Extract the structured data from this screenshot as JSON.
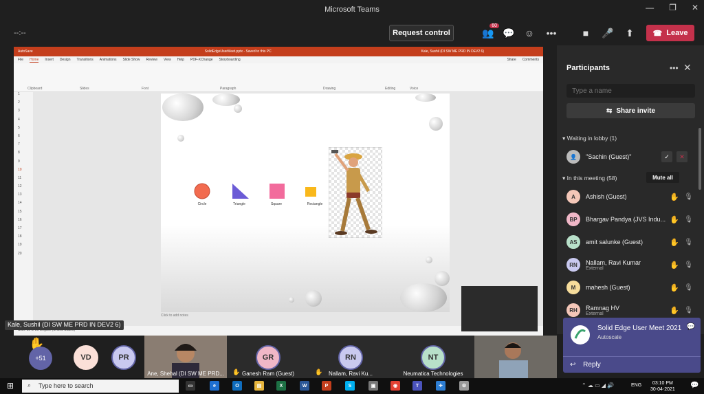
{
  "window": {
    "title": "Microsoft Teams"
  },
  "toolbar": {
    "timer": "--:--",
    "request_control": "Request control",
    "participants_badge": "60",
    "leave_label": "Leave"
  },
  "presentation": {
    "file_title": "SolidEdgeUserMeet.pptx - Saved to this PC",
    "user": "Kale, Sushil (DI SW ME PRD IN DEV2 6)",
    "autosave": "AutoSave",
    "tabs": [
      "File",
      "Home",
      "Insert",
      "Design",
      "Transitions",
      "Animations",
      "Slide Show",
      "Review",
      "View",
      "Help",
      "PDF-XChange",
      "Storyboarding"
    ],
    "share_label": "Share",
    "comments_label": "Comments",
    "ribbon_groups": [
      "Clipboard",
      "Slides",
      "Font",
      "Paragraph",
      "Drawing",
      "Editing",
      "Voice"
    ],
    "slide_numbers": [
      "1",
      "2",
      "3",
      "4",
      "5",
      "6",
      "7",
      "8",
      "9",
      "10",
      "11",
      "12",
      "13",
      "14",
      "15",
      "16",
      "17",
      "18",
      "19",
      "20"
    ],
    "shapes": [
      "Circle",
      "Triangle",
      "Square",
      "Rectangle"
    ],
    "notes_placeholder": "Click to add notes",
    "status": "Slide 10 of 20    English (United States)"
  },
  "presenter_tag": "Kale, Sushil (DI SW ME PRD IN DEV2 6)",
  "participants_panel": {
    "title": "Participants",
    "search_placeholder": "Type a name",
    "share_invite": "Share invite",
    "waiting_header": "Waiting in lobby (1)",
    "lobby": [
      {
        "name": "\"Sachin (Guest)\""
      }
    ],
    "meeting_header": "In this meeting (58)",
    "mute_all": "Mute all",
    "people": [
      {
        "initials": "A",
        "name": "Ashish (Guest)",
        "sub": "",
        "color": "#f4c7b8"
      },
      {
        "initials": "BP",
        "name": "Bhargav Pandya (JVS Indu...",
        "sub": "",
        "color": "#f0b7c7"
      },
      {
        "initials": "AS",
        "name": "amit salunke (Guest)",
        "sub": "",
        "color": "#b8e0c9"
      },
      {
        "initials": "RN",
        "name": "Nallam, Ravi Kumar",
        "sub": "External",
        "color": "#c9c9ef"
      },
      {
        "initials": "M",
        "name": "mahesh (Guest)",
        "sub": "",
        "color": "#f6dc9b"
      },
      {
        "initials": "RH",
        "name": "Ramnag HV",
        "sub": "External",
        "color": "#f4c7b8"
      }
    ]
  },
  "toast": {
    "title": "Solid Edge User Meet 2021",
    "subtitle": "Autoscale",
    "reply": "Reply"
  },
  "video_strip": {
    "raised_hands": "+51",
    "tiles": [
      {
        "initials": "VD",
        "label": ""
      },
      {
        "initials": "PR",
        "label": ""
      },
      {
        "initials": "",
        "label": "Ane, Shehal (DI SW ME PRD..."
      },
      {
        "initials": "GR",
        "label": "Ganesh Ram (Guest)"
      },
      {
        "initials": "RN",
        "label": "Nallam, Ravi Ku..."
      },
      {
        "initials": "NT",
        "label": "Neumatica Technologies"
      },
      {
        "initials": "",
        "label": ""
      }
    ]
  },
  "taskbar": {
    "search_placeholder": "Type here to search",
    "lang": "ENG",
    "time": "03:10 PM",
    "date": "30-04-2021"
  }
}
